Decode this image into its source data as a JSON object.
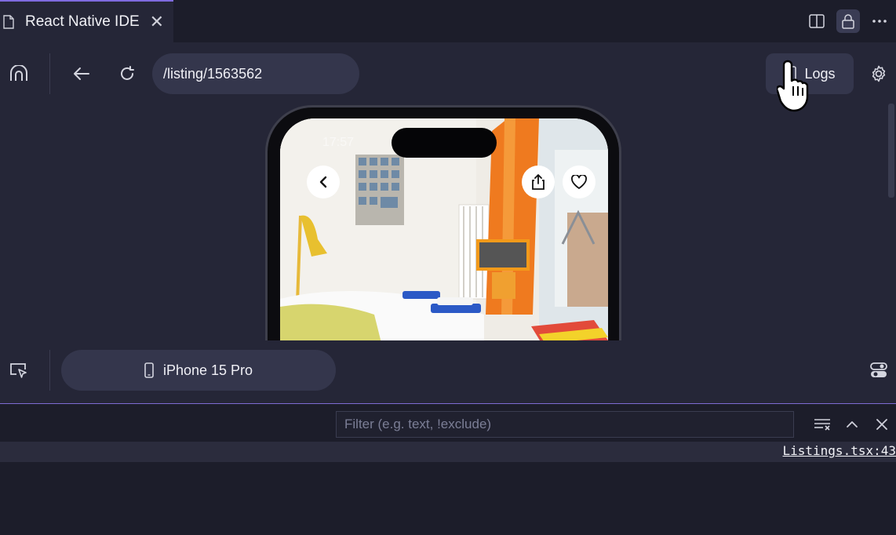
{
  "tab": {
    "title": "React Native IDE",
    "close": "✕"
  },
  "toolbar": {
    "url": "/listing/1563562",
    "logs_label": "Logs"
  },
  "phone": {
    "time": "17:57"
  },
  "device": {
    "label": "iPhone 15 Pro"
  },
  "panel": {
    "filter_placeholder": "Filter (e.g. text, !exclude)",
    "log_link": "Listings.tsx:43"
  },
  "colors": {
    "accent": "#7f6be0",
    "background": "#252637",
    "panel": "#1c1d2a"
  }
}
